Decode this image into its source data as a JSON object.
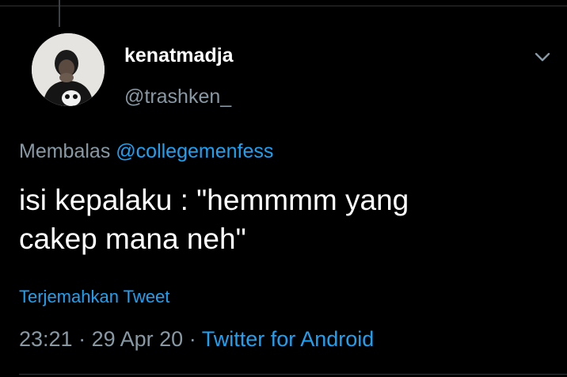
{
  "tweet": {
    "author": {
      "display_name": "kenatmadja",
      "handle": "@trashken_",
      "avatar_icon": "profile-photo"
    },
    "more_icon": "chevron-down-icon",
    "reply_prefix": "Membalas",
    "reply_to": "@collegemenfess",
    "text": "isi kepalaku : \"hemmmm yang\ncakep mana neh\"",
    "translate_label": "Terjemahkan Tweet",
    "time": "23:21",
    "date": "29 Apr 20",
    "source": "Twitter for Android"
  },
  "colors": {
    "background": "#000000",
    "text": "#ffffff",
    "secondary": "#8899a6",
    "link": "#1da1f2"
  }
}
